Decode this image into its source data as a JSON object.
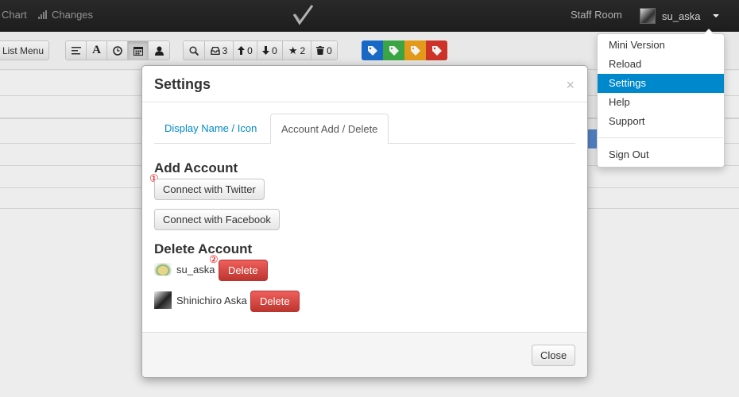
{
  "navbar": {
    "chart_label": "Chart",
    "changes_label": "Changes",
    "staff_room_label": "Staff Room",
    "username": "su_aska"
  },
  "toolbar": {
    "list_menu_label": "List Menu",
    "counters": {
      "inbox": "3",
      "up": "0",
      "down": "0",
      "star": "2",
      "trash": "0"
    },
    "tag_colors": [
      "#1a6fd1",
      "#3fae49",
      "#f0a21b",
      "#d9362b"
    ]
  },
  "modal": {
    "title": "Settings",
    "close_glyph": "×",
    "tabs": [
      {
        "label": "Display Name / Icon"
      },
      {
        "label": "Account Add / Delete"
      }
    ],
    "add_account": {
      "heading": "Add Account",
      "twitter_label": "Connect with Twitter",
      "facebook_label": "Connect with Facebook",
      "marker": "①"
    },
    "delete_account": {
      "heading": "Delete Account",
      "marker": "②",
      "accounts": [
        {
          "name": "su_aska",
          "delete_label": "Delete"
        },
        {
          "name": "Shinichiro Aska",
          "delete_label": "Delete"
        }
      ]
    },
    "close_label": "Close"
  },
  "dropdown": {
    "items": [
      {
        "label": "Mini Version"
      },
      {
        "label": "Reload"
      },
      {
        "label": "Settings"
      },
      {
        "label": "Help"
      },
      {
        "label": "Support"
      },
      {
        "label": "Sign Out"
      }
    ],
    "active": "Settings"
  }
}
